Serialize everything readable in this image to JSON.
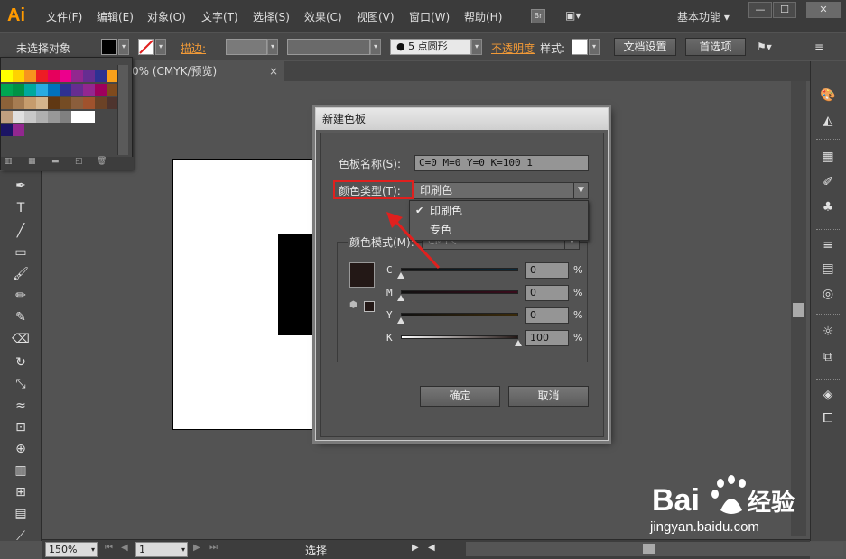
{
  "menubar": {
    "logo": "Ai",
    "items": [
      "文件(F)",
      "编辑(E)",
      "对象(O)",
      "文字(T)",
      "选择(S)",
      "效果(C)",
      "视图(V)",
      "窗口(W)",
      "帮助(H)"
    ],
    "bridge_label": "Br",
    "workspace": "基本功能",
    "workspace_arrow": "▾",
    "win_controls": [
      "—",
      "☐",
      "✕"
    ]
  },
  "ctrlbar": {
    "selection_status": "未选择对象",
    "stroke_label": "描边:",
    "brush_label": "5 点圆形",
    "opacity_label": "不透明度",
    "style_label": "样式:",
    "doc_setup_button": "文档设置",
    "preferences_button": "首选项"
  },
  "document": {
    "tab_title": "0% (CMYK/预览)",
    "tab_close": "×"
  },
  "statusbar": {
    "zoom": "150%",
    "page": "1",
    "tool_status": "选择"
  },
  "dialog": {
    "title": "新建色板",
    "swatch_name_label": "色板名称(S):",
    "swatch_name_value": "C=0 M=0 Y=0 K=100 1",
    "color_type_label": "颜色类型(T):",
    "color_type_value": "印刷色",
    "color_mode_label": "颜色模式(M):",
    "color_mode_value": "CMYK",
    "sliders": [
      {
        "label": "C",
        "value": "0",
        "unit": "%"
      },
      {
        "label": "M",
        "value": "0",
        "unit": "%"
      },
      {
        "label": "Y",
        "value": "0",
        "unit": "%"
      },
      {
        "label": "K",
        "value": "100",
        "unit": "%"
      }
    ],
    "ok_button": "确定",
    "cancel_button": "取消"
  },
  "type_dropdown": {
    "options": [
      "印刷色",
      "专色"
    ],
    "selected": "印刷色"
  },
  "watermark": {
    "text": "jingyan.baidu.com"
  },
  "colors": {
    "accent_orange": "#f29a37",
    "highlight_red": "#e0201e",
    "swatch_preview": "#231816"
  }
}
